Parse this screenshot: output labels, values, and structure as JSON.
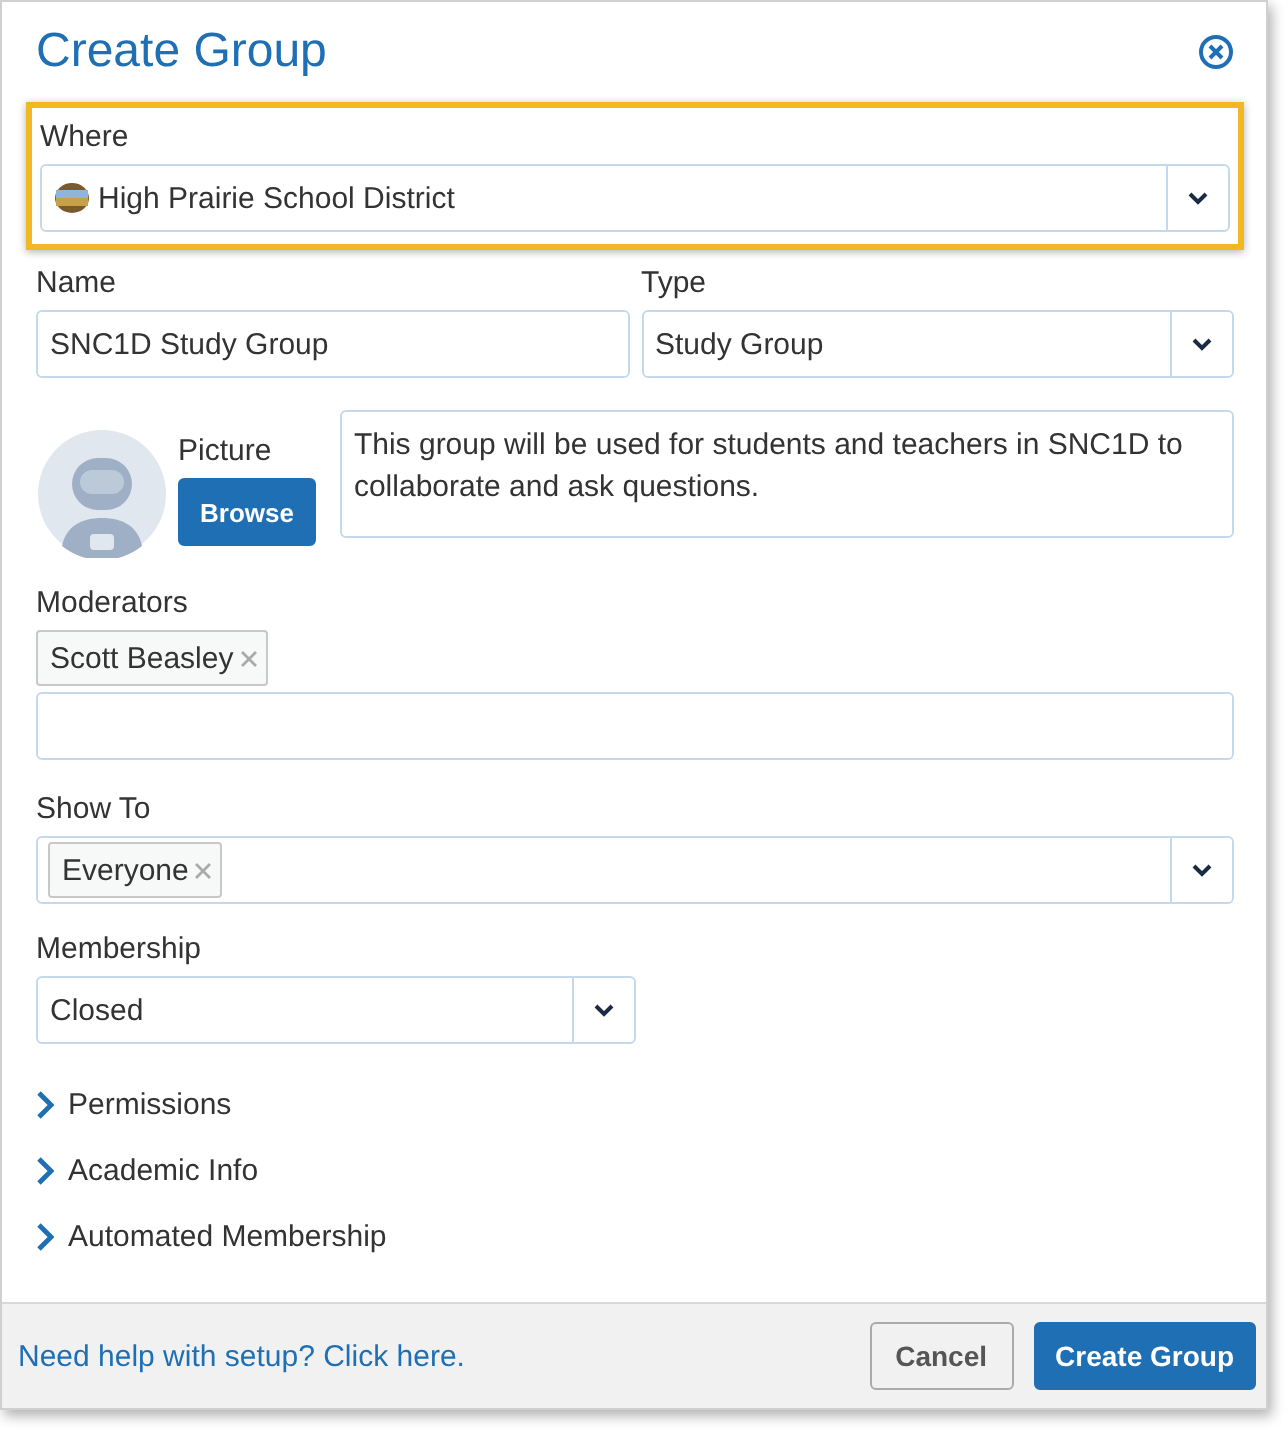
{
  "dialog": {
    "title": "Create Group"
  },
  "where": {
    "label": "Where",
    "value": "High Prairie School District",
    "highlighted": true
  },
  "name": {
    "label": "Name",
    "value": "SNC1D Study Group"
  },
  "type": {
    "label": "Type",
    "value": "Study Group"
  },
  "picture": {
    "label": "Picture",
    "button": "Browse"
  },
  "description": {
    "value": "This group will be used for students and teachers in SNC1D to collaborate and ask questions."
  },
  "moderators": {
    "label": "Moderators",
    "tags": [
      "Scott Beasley"
    ]
  },
  "show_to": {
    "label": "Show To",
    "tags": [
      "Everyone"
    ]
  },
  "membership": {
    "label": "Membership",
    "value": "Closed"
  },
  "sections": [
    {
      "label": "Permissions",
      "expanded": false
    },
    {
      "label": "Academic Info",
      "expanded": false
    },
    {
      "label": "Automated Membership",
      "expanded": false
    }
  ],
  "footer": {
    "help_link": "Need help with setup? Click here.",
    "buttons": [
      {
        "label": "Cancel",
        "kind": "secondary"
      },
      {
        "label": "Create Group",
        "kind": "primary"
      }
    ]
  }
}
